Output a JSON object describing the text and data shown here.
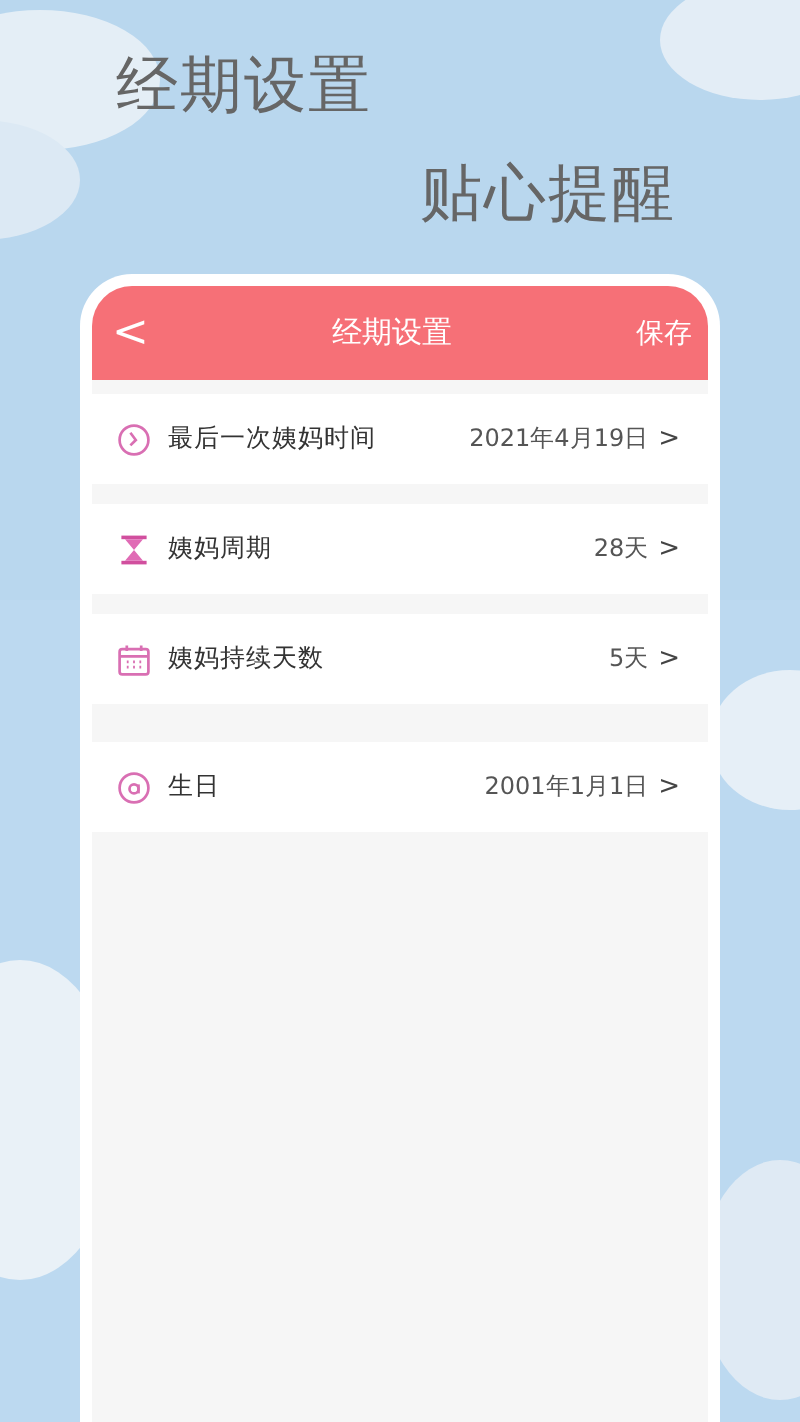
{
  "headline": {
    "title": "经期设置",
    "subtitle": "贴心提醒"
  },
  "app_bar": {
    "back": "<",
    "title": "经期设置",
    "action": "保存"
  },
  "groups": [
    [
      {
        "label": "最后一次姨妈时间",
        "value": "2021年4月19日",
        "chevron": ">"
      },
      {
        "label": "姨妈周期",
        "value": "28天",
        "chevron": ">"
      },
      {
        "label": "姨妈持续天数",
        "value": "5天",
        "chevron": ">"
      }
    ],
    [
      {
        "label": "生日",
        "value": "2001年1月1日",
        "chevron": ">"
      }
    ]
  ]
}
